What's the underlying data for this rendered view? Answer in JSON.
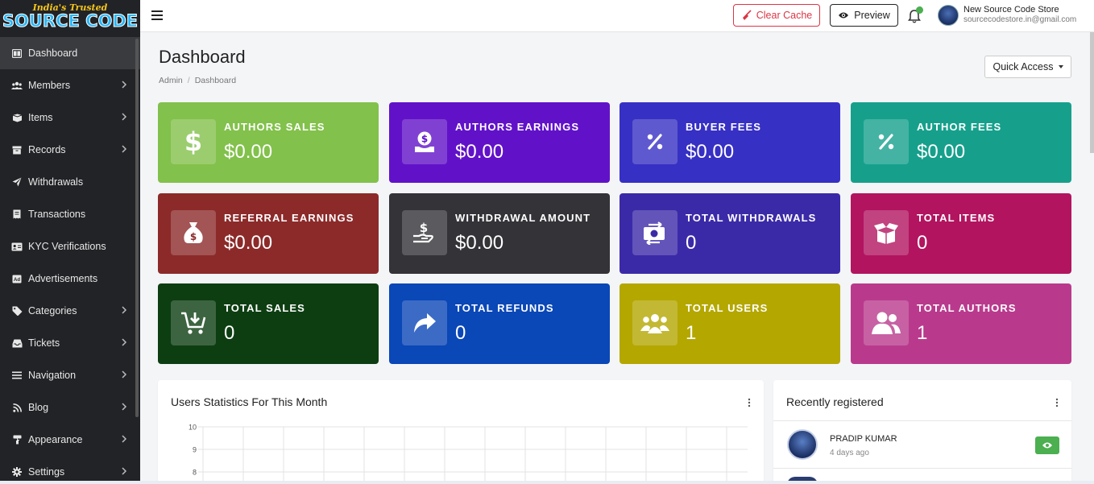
{
  "logo": {
    "line1": "India's Trusted",
    "line2": "SOURCE CODE"
  },
  "sidebar": {
    "items": [
      {
        "label": "Dashboard",
        "icon": "dashboard-icon",
        "chevron": false,
        "active": true
      },
      {
        "label": "Members",
        "icon": "users-icon",
        "chevron": true
      },
      {
        "label": "Items",
        "icon": "box-icon",
        "chevron": true
      },
      {
        "label": "Records",
        "icon": "archive-icon",
        "chevron": true
      },
      {
        "label": "Withdrawals",
        "icon": "paper-plane-icon",
        "chevron": false
      },
      {
        "label": "Transactions",
        "icon": "receipt-icon",
        "chevron": false
      },
      {
        "label": "KYC Verifications",
        "icon": "id-card-icon",
        "chevron": false
      },
      {
        "label": "Advertisements",
        "icon": "ad-icon",
        "chevron": false
      },
      {
        "label": "Categories",
        "icon": "tags-icon",
        "chevron": true
      },
      {
        "label": "Tickets",
        "icon": "inbox-icon",
        "chevron": true
      },
      {
        "label": "Navigation",
        "icon": "bars-icon",
        "chevron": true
      },
      {
        "label": "Blog",
        "icon": "rss-icon",
        "chevron": true
      },
      {
        "label": "Appearance",
        "icon": "paint-roller-icon",
        "chevron": true
      },
      {
        "label": "Settings",
        "icon": "gear-icon",
        "chevron": true
      }
    ]
  },
  "topbar": {
    "clear_cache": "Clear Cache",
    "preview": "Preview",
    "user_name": "New Source Code Store",
    "user_email": "sourcecodestore.in@gmail.com"
  },
  "page": {
    "title": "Dashboard",
    "breadcrumb": [
      "Admin",
      "Dashboard"
    ],
    "quick_access": "Quick Access"
  },
  "stats": [
    {
      "label": "AUTHORS SALES",
      "value": "$0.00",
      "icon": "dollar-icon",
      "color": "#82c14b"
    },
    {
      "label": "AUTHORS EARNINGS",
      "value": "$0.00",
      "icon": "coin-hand-icon",
      "color": "#6112c9"
    },
    {
      "label": "BUYER FEES",
      "value": "$0.00",
      "icon": "percent-icon",
      "color": "#3730c4"
    },
    {
      "label": "AUTHOR FEES",
      "value": "$0.00",
      "icon": "percent-icon",
      "color": "#16a08c"
    },
    {
      "label": "REFERRAL EARNINGS",
      "value": "$0.00",
      "icon": "money-bag-icon",
      "color": "#8c2a2a"
    },
    {
      "label": "WITHDRAWAL AMOUNT",
      "value": "$0.00",
      "icon": "hand-dollar-icon",
      "color": "#333338"
    },
    {
      "label": "TOTAL WITHDRAWALS",
      "value": "0",
      "icon": "money-exchange-icon",
      "color": "#3b2aa8"
    },
    {
      "label": "TOTAL ITEMS",
      "value": "0",
      "icon": "open-box-icon",
      "color": "#b2145f"
    },
    {
      "label": "TOTAL SALES",
      "value": "0",
      "icon": "cart-download-icon",
      "color": "#0d3e12"
    },
    {
      "label": "TOTAL REFUNDS",
      "value": "0",
      "icon": "share-arrow-icon",
      "color": "#0a47b7"
    },
    {
      "label": "TOTAL USERS",
      "value": "1",
      "icon": "users-group-icon",
      "color": "#b4a700"
    },
    {
      "label": "TOTAL AUTHORS",
      "value": "1",
      "icon": "user-friends-icon",
      "color": "#b93a8d"
    }
  ],
  "users_chart": {
    "title": "Users Statistics For This Month",
    "chart_data": {
      "type": "line",
      "title": "Users Statistics For This Month",
      "y_ticks_visible": [
        "10",
        "9",
        "8"
      ],
      "ylim": [
        0,
        10
      ],
      "grid": true
    }
  },
  "recent": {
    "title": "Recently registered",
    "users": [
      {
        "name": "PRADIP KUMAR",
        "time": "4 days ago"
      }
    ]
  }
}
